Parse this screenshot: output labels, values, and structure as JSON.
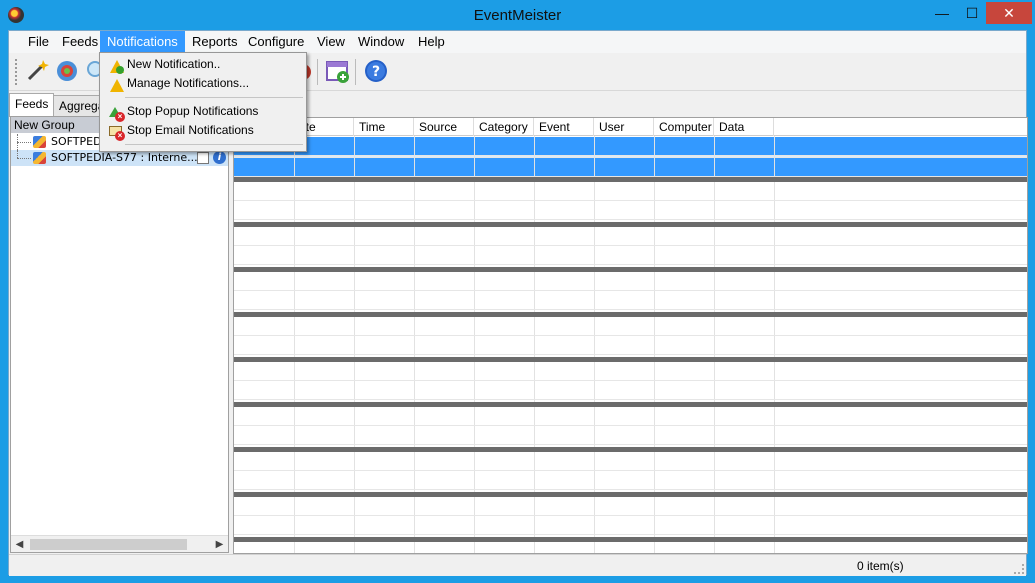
{
  "window": {
    "title": "EventMeister",
    "controls": {
      "minimize": "—",
      "maximize": "☐",
      "close": "✕"
    }
  },
  "menu": {
    "items": [
      "File",
      "Feeds",
      "Notifications",
      "Reports",
      "Configure",
      "View",
      "Window",
      "Help"
    ],
    "active": "Notifications"
  },
  "toolbar": {
    "buttons": [
      "wand-icon",
      "refresh-icon",
      "search-icon",
      "stop-icon",
      "calendar-add-icon",
      "help-icon"
    ]
  },
  "notifications_menu": {
    "new_notification": "New Notification..",
    "manage_notifications": "Manage Notifications...",
    "stop_popup": "Stop  Popup Notifications",
    "stop_email": "Stop Email Notifications"
  },
  "left_pane": {
    "tabs": [
      "Feeds",
      "Aggrega"
    ],
    "tree_header": "New Group",
    "rows": [
      {
        "label": "SOFTPEDI"
      },
      {
        "label": "SOFTPEDIA-S77 : Interne..."
      }
    ]
  },
  "grid": {
    "columns": [
      "ate",
      "Time",
      "Source",
      "Category",
      "Event",
      "User",
      "Computer",
      "Data"
    ]
  },
  "status": {
    "items": "0 item(s)"
  },
  "colors": {
    "title_bar": "#1c9de5",
    "menu_highlight": "#3399ff",
    "selection": "#3399ff",
    "close_button": "#c7463c"
  }
}
